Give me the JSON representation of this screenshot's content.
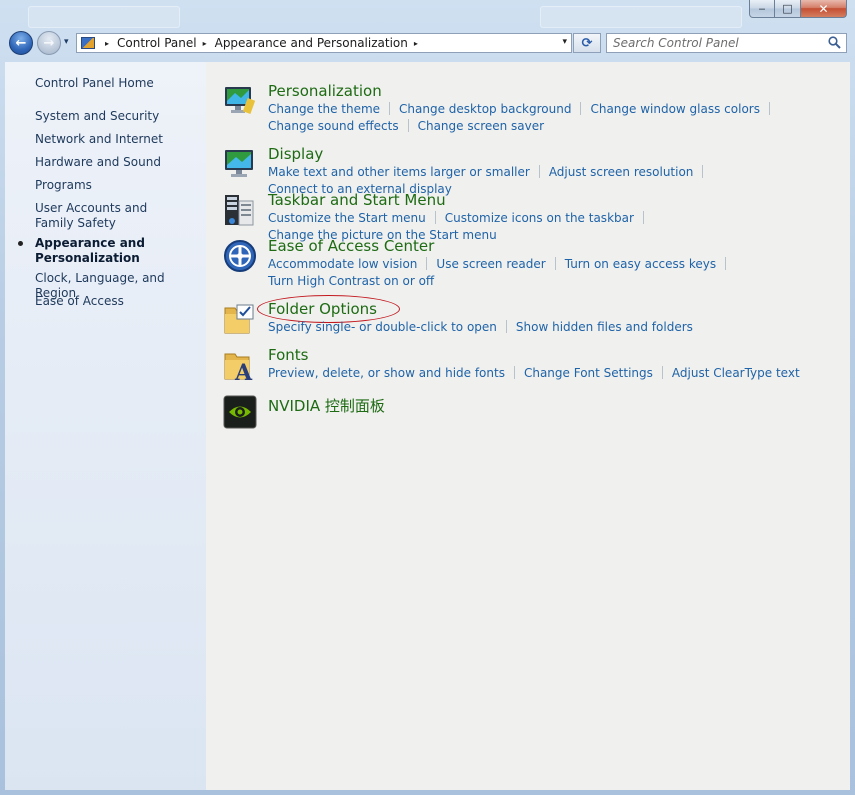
{
  "window": {
    "minimize_glyph": "‒",
    "maximize_glyph": "□",
    "close_glyph": "✕"
  },
  "nav": {
    "back_glyph": "←",
    "forward_glyph": "→",
    "history_glyph": "▾"
  },
  "address": {
    "crumbs": [
      "Control Panel",
      "Appearance and Personalization"
    ],
    "separator_glyph": "▸",
    "dropdown_glyph": "▾",
    "refresh_glyph": "⟳"
  },
  "search": {
    "placeholder": "Search Control Panel",
    "icon": "magnifier-icon"
  },
  "sidebar": {
    "home": "Control Panel Home",
    "items": [
      {
        "label": "System and Security",
        "active": false
      },
      {
        "label": "Network and Internet",
        "active": false
      },
      {
        "label": "Hardware and Sound",
        "active": false
      },
      {
        "label": "Programs",
        "active": false
      },
      {
        "label": "User Accounts and Family Safety",
        "active": false
      },
      {
        "label": "Appearance and Personalization",
        "active": true
      },
      {
        "label": "Clock, Language, and Region",
        "active": false
      },
      {
        "label": "Ease of Access",
        "active": false
      }
    ]
  },
  "categories": [
    {
      "title": "Personalization",
      "icon": "personalization-monitor-icon",
      "links": [
        "Change the theme",
        "Change desktop background",
        "Change window glass colors",
        "Change sound effects",
        "Change screen saver"
      ]
    },
    {
      "title": "Display",
      "icon": "display-monitor-icon",
      "links": [
        "Make text and other items larger or smaller",
        "Adjust screen resolution",
        "Connect to an external display"
      ]
    },
    {
      "title": "Taskbar and Start Menu",
      "icon": "taskbar-start-menu-icon",
      "links": [
        "Customize the Start menu",
        "Customize icons on the taskbar",
        "Change the picture on the Start menu"
      ]
    },
    {
      "title": "Ease of Access Center",
      "icon": "ease-of-access-icon",
      "links": [
        "Accommodate low vision",
        "Use screen reader",
        "Turn on easy access keys",
        "Turn High Contrast on or off"
      ]
    },
    {
      "title": "Folder Options",
      "icon": "folder-options-icon",
      "links": [
        "Specify single- or double-click to open",
        "Show hidden files and folders"
      ]
    },
    {
      "title": "Fonts",
      "icon": "fonts-folder-icon",
      "links": [
        "Preview, delete, or show and hide fonts",
        "Change Font Settings",
        "Adjust ClearType text"
      ]
    },
    {
      "title": "NVIDIA 控制面板",
      "icon": "nvidia-icon",
      "links": []
    }
  ],
  "colors": {
    "category_title": "#1e6b14",
    "link": "#1f63a8",
    "annotation_ellipse": "#c2191f"
  }
}
